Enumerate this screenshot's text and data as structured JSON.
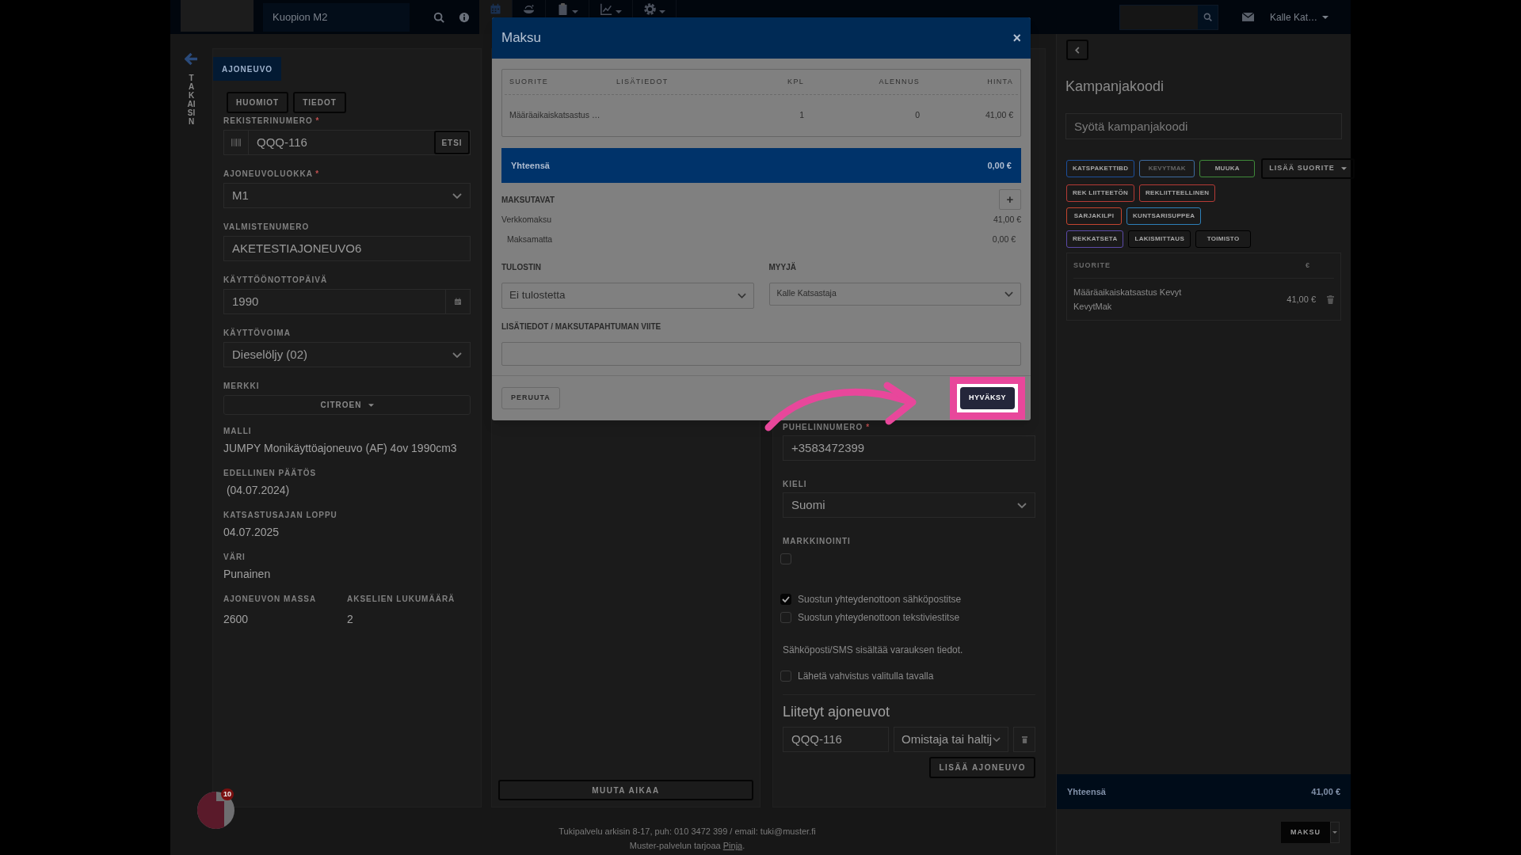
{
  "top_bar": {
    "search_placeholder": "Kuopion M2",
    "nav_items": [
      {
        "kind": "calendar",
        "selected": true,
        "caret": false
      },
      {
        "kind": "bowl",
        "selected": false,
        "caret": false
      },
      {
        "kind": "clipboard",
        "selected": false,
        "caret": true
      },
      {
        "kind": "chart",
        "selected": false,
        "caret": true
      },
      {
        "kind": "gear",
        "selected": false,
        "caret": true
      }
    ],
    "user": "Kalle Kat…"
  },
  "back": {
    "label": "TAKAISIN"
  },
  "vehicle_panel": {
    "tab": "AJONEUVO",
    "buttons": [
      "HUOMIOT",
      "TIEDOT"
    ],
    "fields": [
      {
        "kind": "search",
        "label": "REKISTERINUMERO",
        "required_mark": "*",
        "value": "QQQ-116",
        "button": "ETSI"
      },
      {
        "kind": "select",
        "label": "AJONEUVOLUOKKA",
        "required_mark": "*",
        "value": "M1"
      },
      {
        "kind": "input",
        "label": "VALMISTENUMERO",
        "value": "AKETESTIAJONEUVO6"
      },
      {
        "kind": "date",
        "label": "KÄYTTÖÖNOTTOPÄIVÄ",
        "value": "1990"
      },
      {
        "kind": "select",
        "label": "KÄYTTÖVOIMA",
        "value": "Dieselöljy (02)"
      },
      {
        "kind": "dropdown",
        "label": "MERKKI",
        "value": "CITROEN"
      },
      {
        "kind": "text",
        "label": "MALLI",
        "value": "JUMPY Monikäyttöajoneuvo (AF) 4ov 1990cm3"
      },
      {
        "kind": "text",
        "label": "EDELLINEN PÄÄTÖS",
        "value": " (04.07.2024)"
      },
      {
        "kind": "text",
        "label": "KATSASTUSAJAN LOPPU",
        "value": "04.07.2025"
      },
      {
        "kind": "text",
        "label": "VÄRI",
        "value": "Punainen"
      }
    ],
    "pair": [
      {
        "label": "AJONEUVON MASSA",
        "value": "2600"
      },
      {
        "label": "AKSELIEN LUKUMÄÄRÄ",
        "value": "2"
      }
    ]
  },
  "schedule": {
    "button": "MUUTA AIKAA"
  },
  "customer_form": {
    "phone": {
      "label": "PUHELINNUMERO",
      "required_mark": "*",
      "value": "+3583472399"
    },
    "language": {
      "label": "KIELI",
      "value": "Suomi"
    },
    "marketing": {
      "label": "MARKKINOINTI",
      "checked": false
    },
    "consents": [
      {
        "label": "Suostun yhteydenottoon sähköpostitse",
        "checked": true
      },
      {
        "label": "Suostun yhteydenottoon tekstiviestitse",
        "checked": false
      }
    ],
    "note": "Sähköposti/SMS sisältää varauksen tiedot.",
    "confirmation": {
      "label": "Lähetä vahvistus valitulla tavalla",
      "checked": false
    },
    "linked_heading": "Liitetyt ajoneuvot",
    "linked_vehicles": [
      {
        "plate": "QQQ-116",
        "role": "Omistaja tai haltij"
      }
    ],
    "add_button": "LISÄÄ AJONEUVO"
  },
  "sidebar": {
    "heading": "Kampanjakoodi",
    "code_placeholder": "Syötä kampanjakoodi",
    "tags": [
      {
        "label": "KATSPAKETTIBD",
        "color": "#1c4f9c",
        "disabled": false
      },
      {
        "label": "KEVYTMAK",
        "color": "#3d6a9e",
        "disabled": true
      },
      {
        "label": "MUUKA",
        "color": "#3f8a3a",
        "disabled": false
      },
      {
        "label": "REK LIITTEETÖN",
        "color": "#b53a35",
        "disabled": false
      },
      {
        "label": "REKLIITTEELLINEN",
        "color": "#b53a35",
        "disabled": false
      },
      {
        "label": "SARJAKILPI",
        "color": "#c4452f",
        "disabled": false
      },
      {
        "label": "KUNTSARISUPPEA",
        "color": "#2d7fb8",
        "disabled": false
      },
      {
        "label": "REKKATSETA",
        "color": "#5b4aa8",
        "disabled": false
      },
      {
        "label": "LAKISMITTAUS",
        "color": "#000000",
        "disabled": false
      },
      {
        "label": "TOIMISTO",
        "color": "#000000",
        "disabled": false
      }
    ],
    "add_button": "LISÄÄ SUORITE",
    "table": {
      "columns": [
        "SUORITE",
        "€"
      ],
      "rows": [
        {
          "name": "Määräaikaiskatsastus Kevyt KevytMak",
          "price": "41,00 €"
        }
      ]
    },
    "total": {
      "label": "Yhteensä",
      "value": "41,00 €"
    },
    "pay_button": "MAKSU"
  },
  "footer": {
    "support": "Tukipalvelu arkisin 8-17, puh: 010 3472 399 / email: tuki@muster.fi",
    "provider": "Muster-palvelun tarjoaa ",
    "provider_link": "Pinja",
    "provider_end": "."
  },
  "chat": {
    "badge": "10"
  },
  "modal": {
    "title": "Maksu",
    "close": "×",
    "table": {
      "columns": [
        "SUORITE",
        "LISÄTIEDOT",
        "KPL",
        "ALENNUS",
        "HINTA"
      ],
      "rows": [
        [
          "Määräaikaiskatsastus …",
          "",
          "1",
          "0",
          "41,00 €"
        ]
      ]
    },
    "total": {
      "label": "Yhteensä",
      "value": "0,00 €"
    },
    "methods_label": "MAKSUTAVAT",
    "add": "+",
    "methods": [
      {
        "name": "Verkkomaksu",
        "amount": "41,00 €",
        "indent": false
      },
      {
        "name": "Maksamatta",
        "amount": "0,00 €",
        "indent": true
      }
    ],
    "printer": {
      "label": "TULOSTIN",
      "value": "Ei tulostetta"
    },
    "seller": {
      "label": "MYYJÄ",
      "value": "Kalle Katsastaja"
    },
    "reference": {
      "label": "LISÄTIEDOT / MAKSUTAPAHTUMAN VIITE"
    },
    "cancel": "PERUUTA",
    "accept": "HYVÄKSY",
    "accept_highlighted": true
  }
}
